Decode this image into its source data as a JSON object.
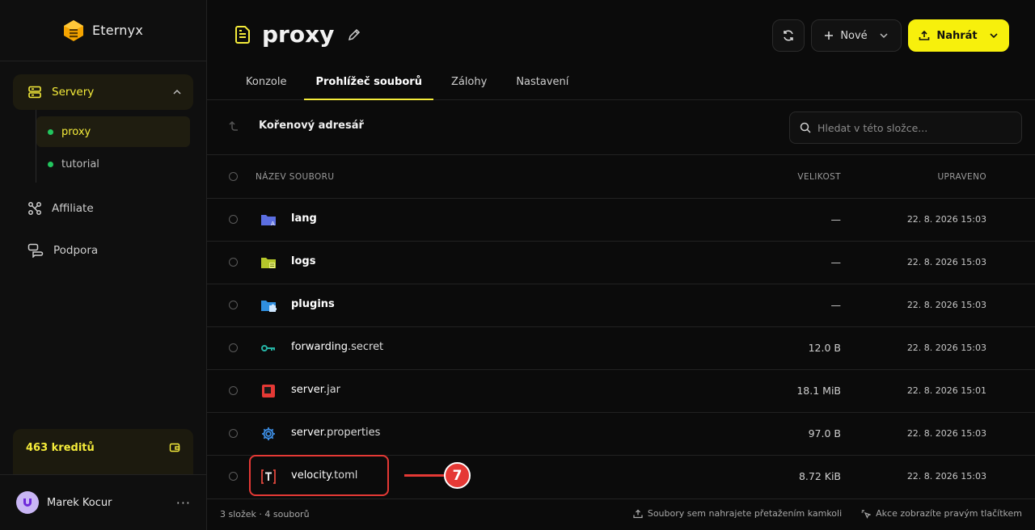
{
  "brand": {
    "name": "Eternyx"
  },
  "sidebar": {
    "group": {
      "label": "Servery"
    },
    "servers": [
      {
        "label": "proxy",
        "active": true
      },
      {
        "label": "tutorial",
        "active": false
      }
    ],
    "items": [
      {
        "label": "Affiliate"
      },
      {
        "label": "Podpora"
      }
    ],
    "credits": "463 kreditů",
    "user": {
      "name": "Marek Kocur",
      "more": "···"
    }
  },
  "header": {
    "title": "proxy",
    "new_label": "Nové",
    "upload_label": "Nahrát",
    "tabs": [
      {
        "label": "Konzole",
        "active": false
      },
      {
        "label": "Prohlížeč souborů",
        "active": true
      },
      {
        "label": "Zálohy",
        "active": false
      },
      {
        "label": "Nastavení",
        "active": false
      }
    ]
  },
  "toolbar": {
    "path": "Kořenový adresář",
    "search_placeholder": "Hledat v této složce..."
  },
  "table": {
    "columns": {
      "name": "NÁZEV SOUBORU",
      "size": "VELIKOST",
      "date": "UPRAVENO"
    },
    "rows": [
      {
        "base": "lang",
        "ext": "",
        "size": "—",
        "date": "22. 8. 2026 15:03",
        "icon": "folder-translate-icon"
      },
      {
        "base": "logs",
        "ext": "",
        "size": "—",
        "date": "22. 8. 2026 15:03",
        "icon": "folder-logs-icon"
      },
      {
        "base": "plugins",
        "ext": "",
        "size": "—",
        "date": "22. 8. 2026 15:03",
        "icon": "folder-puzzle-icon"
      },
      {
        "base": "forwarding",
        "ext": ".secret",
        "size": "12.0 B",
        "date": "22. 8. 2026 15:03",
        "icon": "key-icon"
      },
      {
        "base": "server",
        "ext": ".jar",
        "size": "18.1 MiB",
        "date": "22. 8. 2026 15:01",
        "icon": "jar-icon"
      },
      {
        "base": "server",
        "ext": ".properties",
        "size": "97.0 B",
        "date": "22. 8. 2026 15:03",
        "icon": "gear-icon"
      },
      {
        "base": "velocity",
        "ext": ".toml",
        "size": "8.72 KiB",
        "date": "22. 8. 2026 15:03",
        "icon": "toml-icon"
      }
    ]
  },
  "annotation": {
    "number": "7"
  },
  "footer": {
    "summary": "3 složek · 4 souborů",
    "drag_hint": "Soubory sem nahrajete přetažením kamkoli",
    "right_click_hint": "Akce zobrazíte pravým tlačítkem"
  },
  "colors": {
    "accent": "#f7f00c",
    "online": "#22c55e",
    "annotation": "#e53935"
  }
}
